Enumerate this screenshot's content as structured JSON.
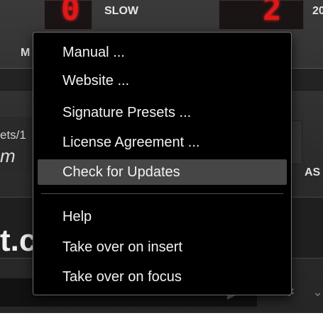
{
  "background": {
    "slow_label": "SLOW",
    "right_label": "20",
    "digit_left": "0",
    "digit_right": "2",
    "side_label_left": "M",
    "side_label_right": "AS",
    "preset_path": "ets/1",
    "preset_name": "m",
    "logo_fragment": "t.c"
  },
  "menu": {
    "items": [
      {
        "label": "Manual ..."
      },
      {
        "label": "Website ..."
      },
      {
        "label": "Signature Presets ..."
      },
      {
        "label": "License Agreement ..."
      },
      {
        "label": "Check for Updates",
        "highlighted": true
      },
      {
        "label": "Help"
      },
      {
        "label": "Take over on insert"
      },
      {
        "label": "Take over on focus"
      }
    ]
  },
  "colors": {
    "menu_bg": "#000000",
    "highlight": "#464646",
    "led_red": "#e01818"
  }
}
